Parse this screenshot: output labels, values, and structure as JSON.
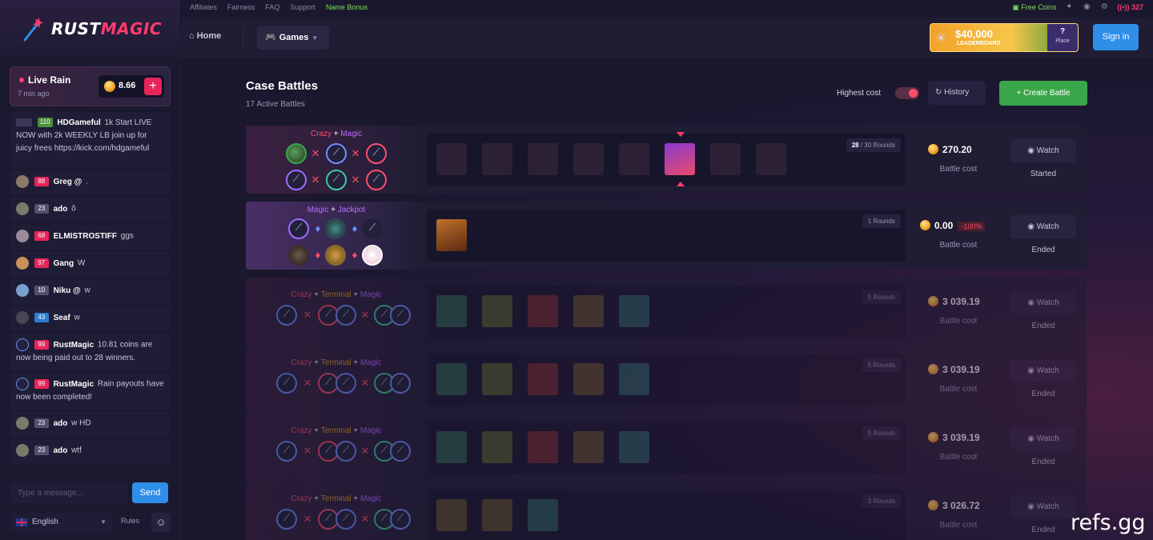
{
  "brand": {
    "part1": "RUST",
    "part2": "MAGIC"
  },
  "topbar": {
    "links": [
      "Affiliates",
      "Fairness",
      "FAQ",
      "Support",
      "Name Bonus"
    ],
    "free_coins": "Free Coins",
    "online_count": "327"
  },
  "nav": {
    "home": "Home",
    "games": "Games",
    "leaderboard_amount": "$40,000",
    "leaderboard_label": "LEADERBOARD",
    "leaderboard_place_q": "?",
    "leaderboard_place_label": "Place",
    "signin": "Sign in"
  },
  "rain": {
    "title": "Live Rain",
    "time": "7 min ago",
    "amount": "8.66",
    "plus": "+"
  },
  "chat": [
    {
      "level": "110",
      "level_color": "green",
      "user": "HDGameful",
      "text": "1k Start LIVE NOW with 2k WEEKLY LB join up for juicy frees https://kick.com/hdgameful"
    },
    {
      "level": "88",
      "level_color": "red",
      "user": "Greg @",
      "text": "."
    },
    {
      "level": "23",
      "level_color": "grey",
      "user": "ado",
      "text": "ô"
    },
    {
      "level": "68",
      "level_color": "red",
      "user": "ELMISTROSTIFF",
      "text": "ggs"
    },
    {
      "level": "97",
      "level_color": "red",
      "user": "Gang",
      "text": "W"
    },
    {
      "level": "10",
      "level_color": "grey",
      "user": "Niku @",
      "text": "w"
    },
    {
      "level": "43",
      "level_color": "blue",
      "user": "Seaf",
      "text": "w"
    },
    {
      "level": "99",
      "level_color": "red",
      "user": "RustMagic",
      "text": "10.81 coins are now being paid out to 28 winners."
    },
    {
      "level": "99",
      "level_color": "red",
      "user": "RustMagic",
      "text": "Rain payouts have now been completed!"
    },
    {
      "level": "23",
      "level_color": "grey",
      "user": "ado",
      "text": "w HD"
    },
    {
      "level": "23",
      "level_color": "grey",
      "user": "ado",
      "text": "wtf"
    }
  ],
  "chat_input": {
    "placeholder": "Type a message...",
    "send": "Send"
  },
  "footer": {
    "language": "English",
    "rules": "Rules"
  },
  "page": {
    "title": "Case Battles",
    "subtitle": "17 Active Battles",
    "highest_cost": "Highest cost",
    "history": "History",
    "create": "Create Battle"
  },
  "battles": [
    {
      "modes": [
        "Crazy",
        "Magic"
      ],
      "rounds_current": "28",
      "rounds_text": " / 30 Rounds",
      "cost": "270.20",
      "cost_label": "Battle cost",
      "watch": "Watch",
      "status": "Started"
    },
    {
      "modes": [
        "Magic",
        "Jackpot"
      ],
      "rounds_current": "",
      "rounds_text": "1 Rounds",
      "cost": "0.00",
      "pct": "-100%",
      "cost_label": "Battle cost",
      "watch": "Watch",
      "status": "Ended"
    },
    {
      "modes": [
        "Crazy",
        "Terminal",
        "Magic"
      ],
      "rounds_current": "",
      "rounds_text": "5 Rounds",
      "cost": "3 039.19",
      "cost_label": "Battle cost",
      "watch": "Watch",
      "status": "Ended"
    },
    {
      "modes": [
        "Crazy",
        "Terminal",
        "Magic"
      ],
      "rounds_current": "",
      "rounds_text": "5 Rounds",
      "cost": "3 039.19",
      "cost_label": "Battle cost",
      "watch": "Watch",
      "status": "Ended"
    },
    {
      "modes": [
        "Crazy",
        "Terminal",
        "Magic"
      ],
      "rounds_current": "",
      "rounds_text": "5 Rounds",
      "cost": "3 039.19",
      "cost_label": "Battle cost",
      "watch": "Watch",
      "status": "Ended"
    },
    {
      "modes": [
        "Crazy",
        "Terminal",
        "Magic"
      ],
      "rounds_current": "",
      "rounds_text": "3 Rounds",
      "cost": "3 026.72",
      "cost_label": "Battle cost",
      "watch": "Watch",
      "status": "Ended"
    }
  ],
  "watermark": "refs.gg",
  "colors": {
    "accent": "#ff3b6f",
    "primary_blue": "#2f8ee8",
    "green": "#3aa64a"
  }
}
